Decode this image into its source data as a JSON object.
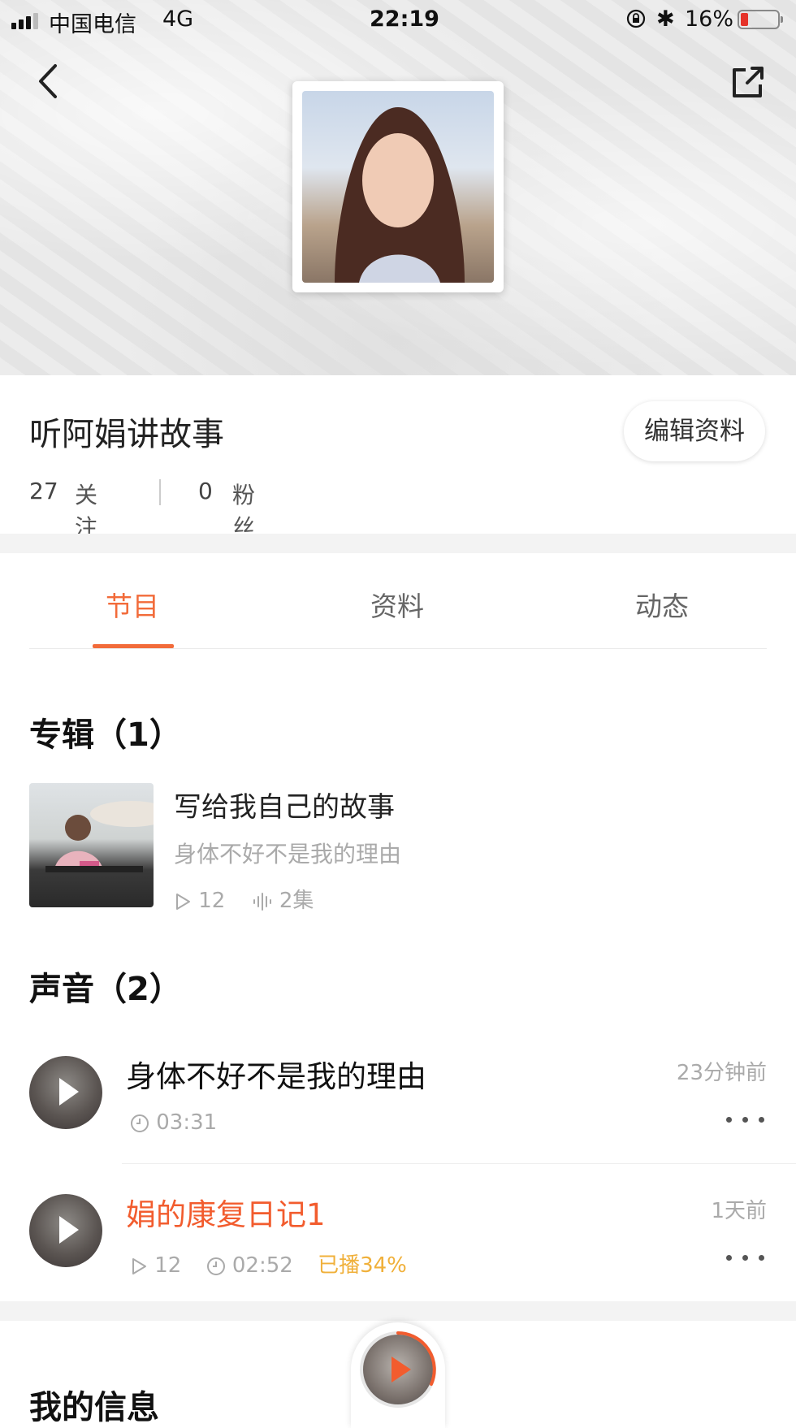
{
  "status_bar": {
    "carrier": "中国电信",
    "network": "4G",
    "time": "22:19",
    "battery": "16%",
    "battery_color": "#e5332a"
  },
  "header": {
    "back_icon": "chevron-left-icon",
    "share_icon": "share-external-icon"
  },
  "profile": {
    "name": "听阿娟讲故事",
    "edit_button": "编辑资料",
    "following_count": "27",
    "following_label": "关注",
    "followers_count": "0",
    "followers_label": "粉丝"
  },
  "tabs": [
    {
      "label": "节目",
      "active": true
    },
    {
      "label": "资料",
      "active": false
    },
    {
      "label": "动态",
      "active": false
    }
  ],
  "albums_section": {
    "title": "专辑（1）",
    "items": [
      {
        "title": "写给我自己的故事",
        "subtitle": "身体不好不是我的理由",
        "plays": "12",
        "episodes": "2集"
      }
    ]
  },
  "tracks_section": {
    "title": "声音（2）",
    "items": [
      {
        "title": "身体不好不是我的理由",
        "time_ago": "23分钟前",
        "duration": "03:31",
        "plays": "",
        "progress": ""
      },
      {
        "title": "娟的康复日记1",
        "time_ago": "1天前",
        "duration": "02:52",
        "plays": "12",
        "progress": "已播34%",
        "playing": true
      }
    ]
  },
  "info_section": {
    "title": "我的信息"
  },
  "accent_color": "#f26b3a"
}
